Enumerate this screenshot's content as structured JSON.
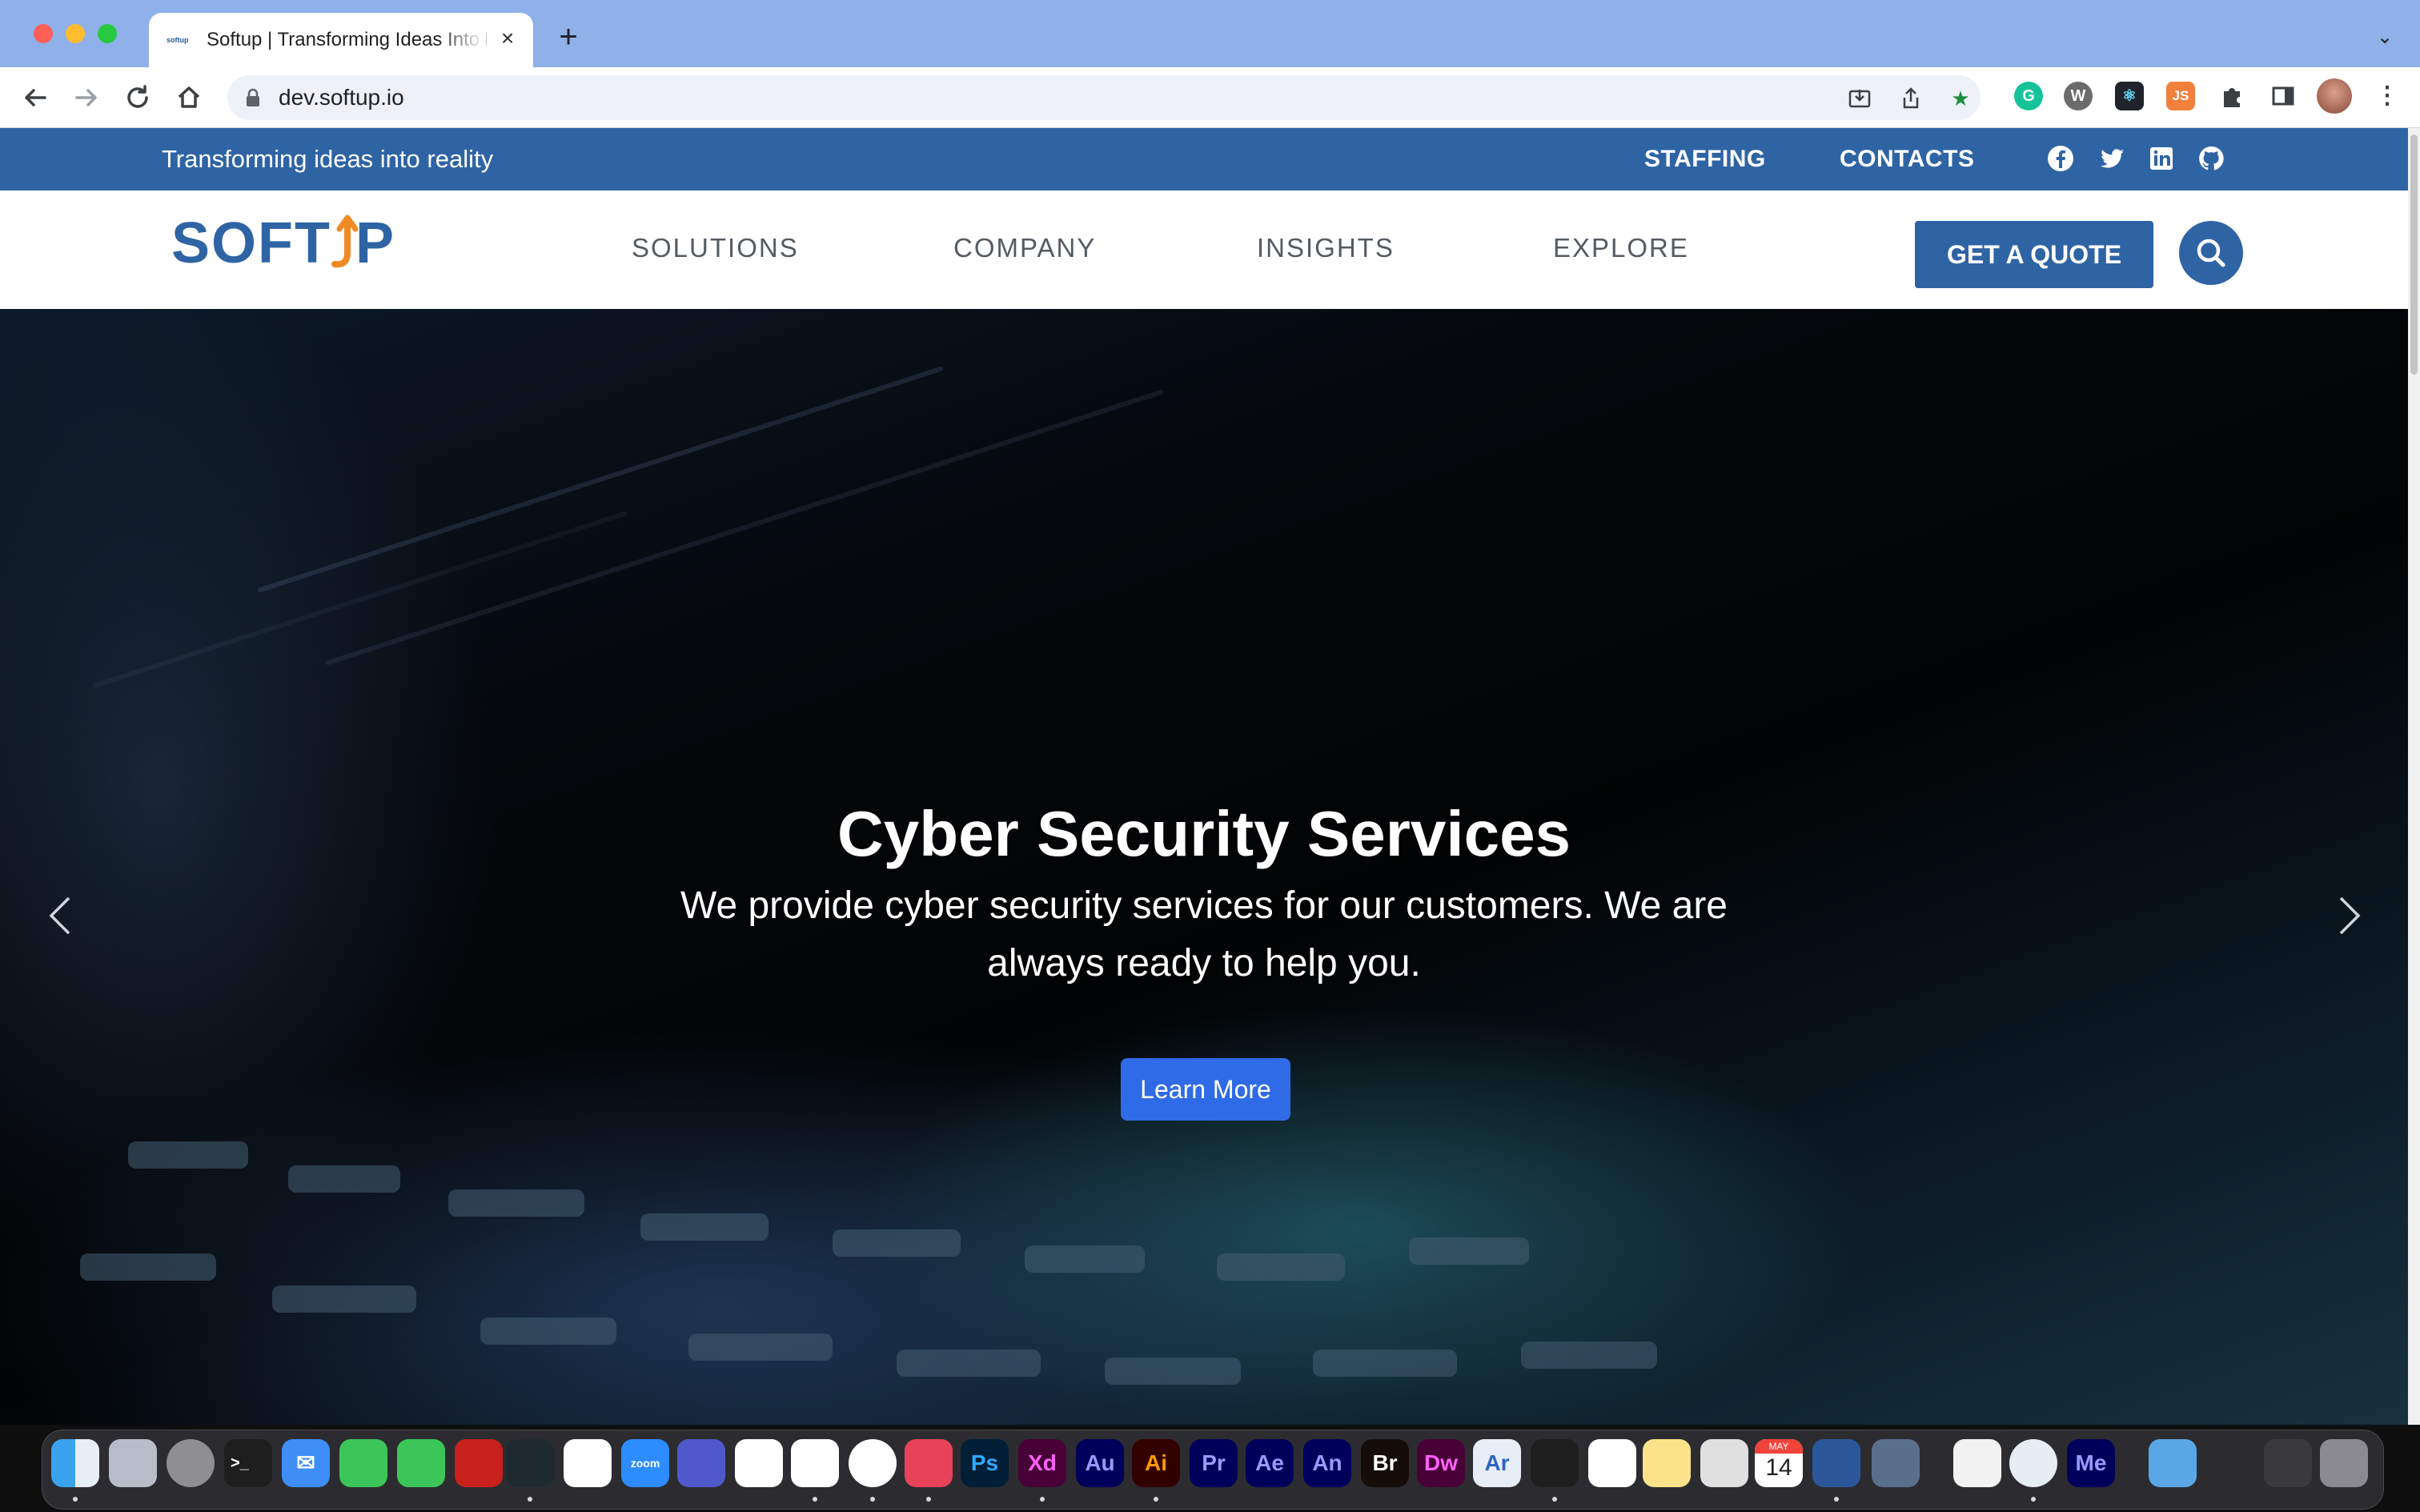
{
  "browser": {
    "tab_title": "Softup | Transforming Ideas Into Reality",
    "tab_favicon_text": "softup",
    "url": "dev.softup.io"
  },
  "topbar": {
    "tagline": "Transforming ideas into reality",
    "links": [
      "STAFFING",
      "CONTACTS"
    ],
    "social_icons": [
      "facebook-icon",
      "twitter-icon",
      "linkedin-icon",
      "github-icon"
    ]
  },
  "navbar": {
    "logo_text": "SOFTUP",
    "menu": [
      "SOLUTIONS",
      "COMPANY",
      "INSIGHTS",
      "EXPLORE"
    ],
    "cta": "GET A QUOTE"
  },
  "hero": {
    "title": "Cyber Security Services",
    "description": "We provide cyber security services for our customers. We are always ready to help you.",
    "button": "Learn More"
  },
  "extensions": [
    "G",
    "W",
    "⚛",
    "JS"
  ],
  "dock": {
    "apps": [
      "Ps",
      "Xd",
      "Au",
      "Ai",
      "Pr",
      "Ae",
      "An",
      "Br",
      "Dw",
      "Ar",
      "Me"
    ],
    "calendar": {
      "month": "MAY",
      "day": "14"
    },
    "zoom_label": "zoom"
  },
  "colors": {
    "brand_blue": "#2f64a4",
    "logo_orange": "#f08a24",
    "learn_more_blue": "#2f6be6"
  }
}
